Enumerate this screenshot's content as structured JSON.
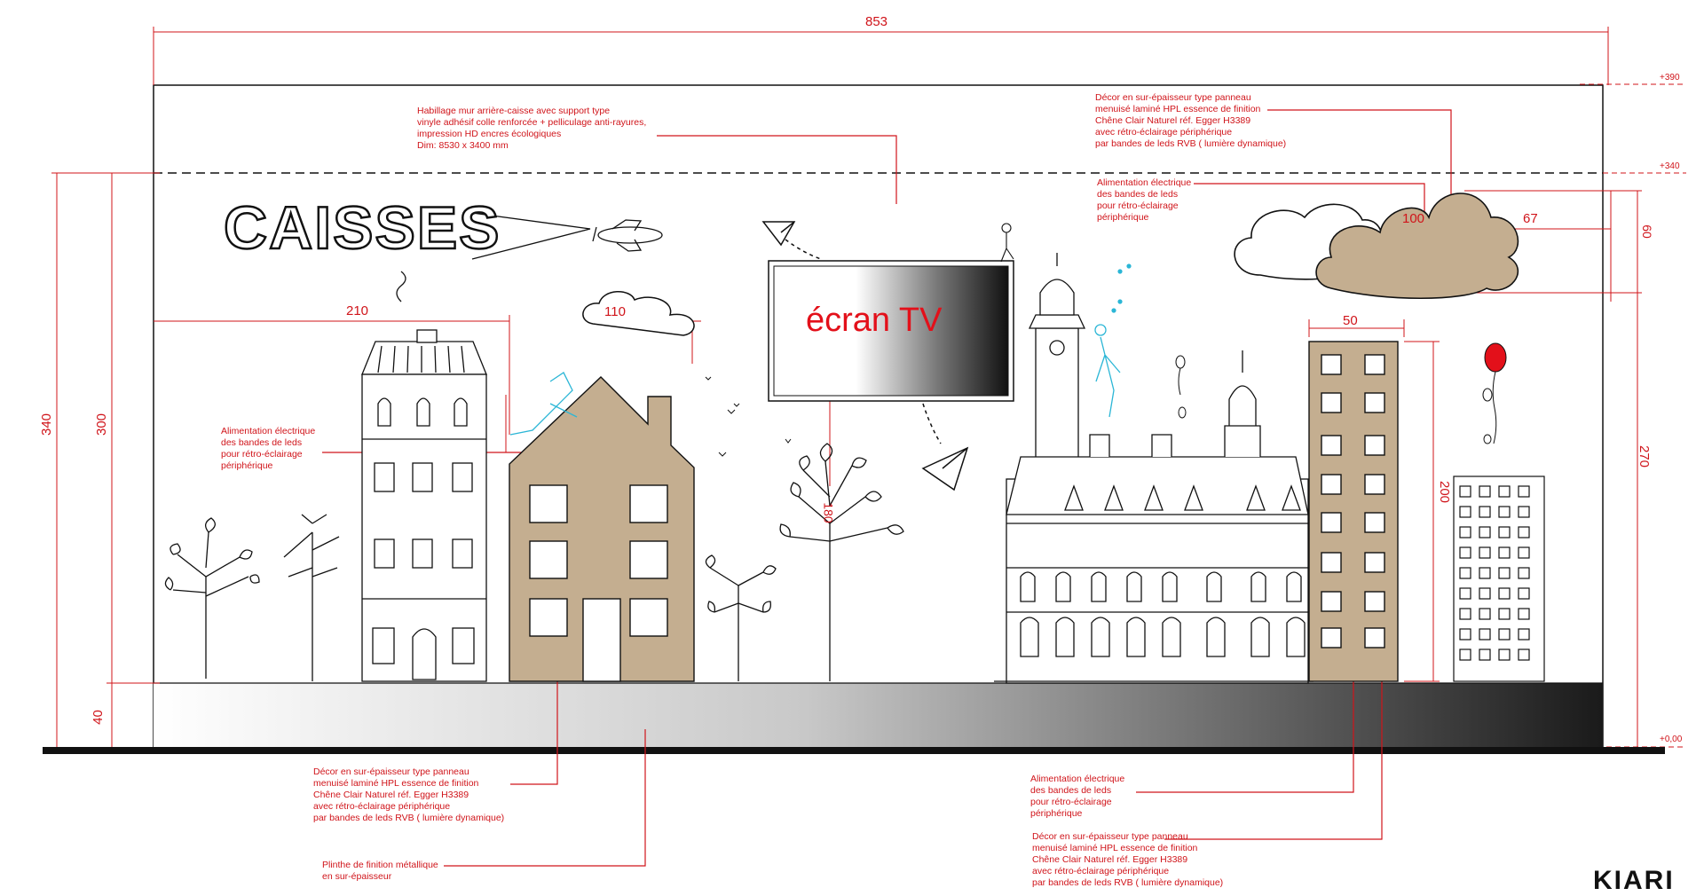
{
  "title": "CAISSES",
  "screen_label": "écran TV",
  "dimensions": {
    "total_width": "853",
    "height_340": "340",
    "height_300": "300",
    "plinth_40": "40",
    "house_210": "210",
    "cloud_110": "110",
    "cloud_100": "100",
    "cloud_67": "67",
    "tower_50": "50",
    "tower_200": "200",
    "right_270": "270",
    "right_60": "60",
    "tree_180": "180"
  },
  "levels": {
    "top": "+390",
    "dashed": "+340",
    "floor": "+0,00"
  },
  "notes": {
    "wall_covering": [
      "Habillage mur arrière-caisse avec support type",
      "vinyle adhésif colle renforcée + pelliculage anti-rayures,",
      "impression HD encres écologiques",
      "Dim: 8530 x 3400 mm"
    ],
    "decor_top": [
      "Décor en sur-épaisseur type panneau",
      "menuisé laminé HPL  essence de finition",
      "Chêne Clair Naturel réf. Egger H3389",
      "avec rétro-éclairage périphérique",
      "par bandes de leds RVB ( lumière dynamique)"
    ],
    "power_top": [
      "Alimentation électrique",
      "des bandes de leds",
      "pour rétro-éclairage",
      "périphérique"
    ],
    "power_left": [
      "Alimentation électrique",
      "des bandes de leds",
      "pour rétro-éclairage",
      "périphérique"
    ],
    "decor_bottom_left": [
      "Décor en sur-épaisseur type panneau",
      "menuisé laminé HPL  essence de finition",
      "Chêne Clair Naturel réf. Egger H3389",
      "avec rétro-éclairage périphérique",
      "par bandes de leds RVB ( lumière dynamique)"
    ],
    "plinth": [
      "Plinthe de finition métallique",
      "en sur-épaisseur"
    ],
    "power_bottom_right": [
      "Alimentation électrique",
      "des bandes de leds",
      "pour rétro-éclairage",
      "périphérique"
    ],
    "decor_bottom_right": [
      "Décor en sur-épaisseur type panneau",
      "menuisé laminé HPL  essence de finition",
      "Chêne Clair Naturel réf. Egger H3389",
      "avec rétro-éclairage périphérique",
      "par bandes de leds RVB ( lumière dynamique)"
    ]
  },
  "corner_text": "KIARI",
  "colors": {
    "annotation": "#d0141a",
    "wood": "#c4ae90",
    "ink": "#111111",
    "balloon": "#e3101a"
  }
}
